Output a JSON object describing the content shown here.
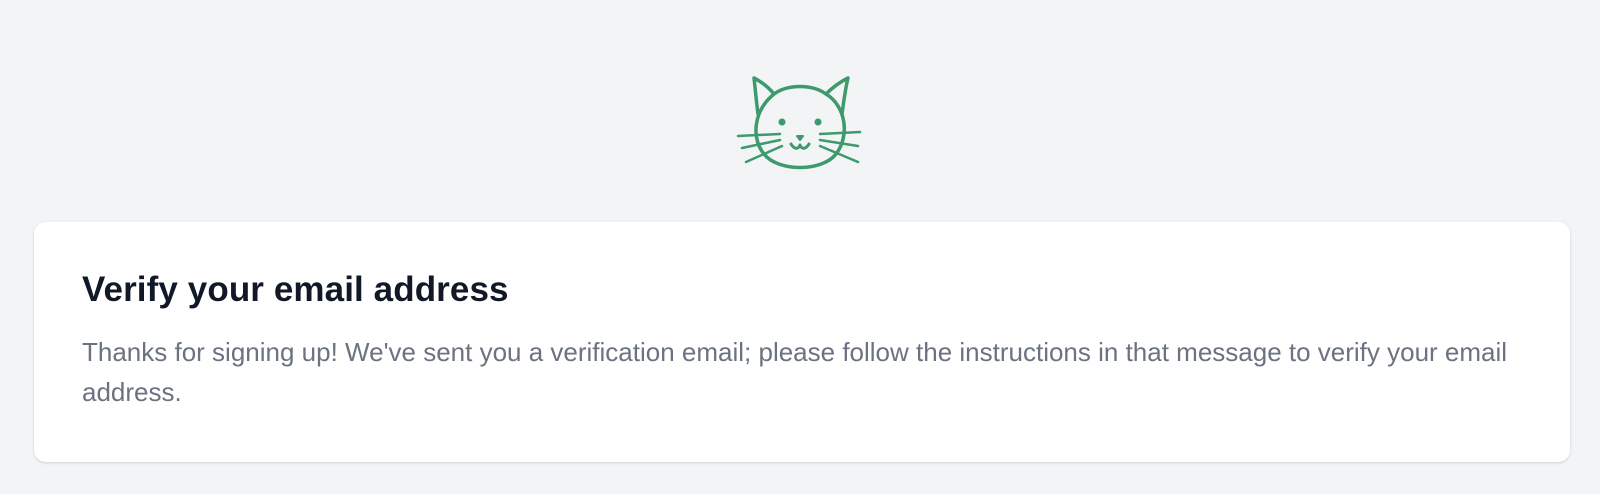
{
  "brand": {
    "logo_icon": "cat-icon",
    "logo_color": "#3d9a6c"
  },
  "card": {
    "title": "Verify your email address",
    "message": "Thanks for signing up! We've sent you a verification email; please follow the instructions in that message to verify your email address."
  }
}
